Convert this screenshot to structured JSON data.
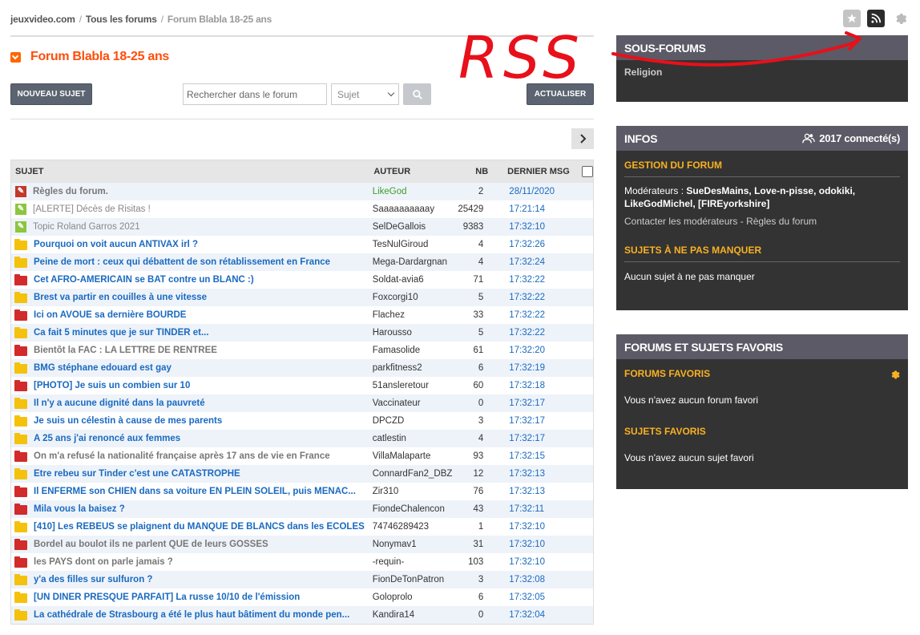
{
  "breadcrumb": {
    "site": "jeuxvideo.com",
    "forums": "Tous les forums",
    "current": "Forum Blabla 18-25 ans"
  },
  "forum": {
    "title": "Forum Blabla 18-25 ans"
  },
  "toolbar": {
    "new_topic": "NOUVEAU SUJET",
    "search_placeholder": "Rechercher dans le forum",
    "search_scope": "Sujet",
    "refresh": "ACTUALISER"
  },
  "table": {
    "headers": {
      "subject": "SUJET",
      "author": "AUTEUR",
      "nb": "NB",
      "last": "DERNIER MSG"
    },
    "rows": [
      {
        "icon": "pin-red",
        "subject": "Règles du forum.",
        "author": "LikeGod",
        "nb": "2",
        "last": "28/11/2020"
      },
      {
        "icon": "pin-green",
        "subject": "[ALERTE] Décès de Risitas !",
        "author": "Saaaaaaaaaay",
        "nb": "25429",
        "last": "17:21:14"
      },
      {
        "icon": "pin-green",
        "subject": "Topic Roland Garros 2021",
        "author": "SelDeGallois",
        "nb": "9383",
        "last": "17:32:10"
      },
      {
        "icon": "folder-yellow",
        "subject": "Pourquoi on voit aucun ANTIVAX irl ?",
        "author": "TesNulGiroud",
        "nb": "4",
        "last": "17:32:26"
      },
      {
        "icon": "folder-yellow",
        "subject": "Peine de mort : ceux qui débattent de son rétablissement en France",
        "author": "Mega-Dardargnan",
        "nb": "4",
        "last": "17:32:24"
      },
      {
        "icon": "folder-red",
        "subject": "Cet AFRO-AMÉRICAIN se BAT contre un BLANC :)",
        "author": "Soldat-avia6",
        "nb": "71",
        "last": "17:32:22"
      },
      {
        "icon": "folder-yellow",
        "subject": "Brest va partir en couilles à une vitesse",
        "author": "Foxcorgi10",
        "nb": "5",
        "last": "17:32:22"
      },
      {
        "icon": "folder-red",
        "subject": "Ici on AVOUE sa dernière BOURDE",
        "author": "Flachez",
        "nb": "33",
        "last": "17:32:22"
      },
      {
        "icon": "folder-yellow",
        "subject": "Ca fait 5 minutes que je sur TINDER et...",
        "author": "Harousso",
        "nb": "5",
        "last": "17:32:22"
      },
      {
        "icon": "folder-red",
        "subject": "Bientôt la FAC : LA LETTRE DE RENTRÉE",
        "author": "Famasolide",
        "nb": "61",
        "last": "17:32:20"
      },
      {
        "icon": "folder-yellow",
        "subject": "BMG stéphane edouard est gay",
        "author": "parkfitness2",
        "nb": "6",
        "last": "17:32:19"
      },
      {
        "icon": "folder-red",
        "subject": "[PHOTO] Je suis un combien sur 10",
        "author": "51ansleretour",
        "nb": "60",
        "last": "17:32:18"
      },
      {
        "icon": "folder-yellow",
        "subject": "Il n'y a aucune dignité dans la pauvreté",
        "author": "Vaccinateur",
        "nb": "0",
        "last": "17:32:17"
      },
      {
        "icon": "folder-yellow",
        "subject": "Je suis un célestin à cause de mes parents",
        "author": "DPCZD",
        "nb": "3",
        "last": "17:32:17"
      },
      {
        "icon": "folder-yellow",
        "subject": "A 25 ans j'ai renoncé aux femmes",
        "author": "catlestin",
        "nb": "4",
        "last": "17:32:17"
      },
      {
        "icon": "folder-red",
        "subject": "On m'a refusé la nationalité française après 17 ans de vie en France",
        "author": "VillaMalaparte",
        "nb": "93",
        "last": "17:32:15"
      },
      {
        "icon": "folder-yellow",
        "subject": "Être rebeu sur Tinder c'est une CATASTROPHE",
        "author": "ConnardFan2_DBZ",
        "nb": "12",
        "last": "17:32:13"
      },
      {
        "icon": "folder-red",
        "subject": "Il ENFERME son CHIEN dans sa voiture EN PLEIN SOLEIL, puis MENAC...",
        "author": "Zir310",
        "nb": "76",
        "last": "17:32:13"
      },
      {
        "icon": "folder-red",
        "subject": "Mila vous la baisez ?",
        "author": "FiondeChalencon",
        "nb": "43",
        "last": "17:32:11"
      },
      {
        "icon": "folder-yellow",
        "subject": "[410] Les REBEUS se plaignent du MANQUE DE BLANCS dans les ÉCOLES",
        "author": "74746289423",
        "nb": "1",
        "last": "17:32:10"
      },
      {
        "icon": "folder-red",
        "subject": "Bordel au boulot ils ne parlent QUE de leurs GOSSES",
        "author": "Nonymav1",
        "nb": "31",
        "last": "17:32:10"
      },
      {
        "icon": "folder-red",
        "subject": "les PAYS dont on parle jamais ?",
        "author": "-requin-",
        "nb": "103",
        "last": "17:32:10"
      },
      {
        "icon": "folder-yellow",
        "subject": "y'a des filles sur sulfuron ?",
        "author": "FionDeTonPatron",
        "nb": "3",
        "last": "17:32:08"
      },
      {
        "icon": "folder-yellow",
        "subject": "[UN DÎNER PRESQUE PARFAIT] La russe 10/10 de l'émission",
        "author": "Goloprolo",
        "nb": "6",
        "last": "17:32:05"
      },
      {
        "icon": "folder-yellow",
        "subject": "La cathédrale de Strasbourg a été le plus haut bâtiment du monde pen...",
        "author": "Kandira14",
        "nb": "0",
        "last": "17:32:04"
      }
    ]
  },
  "sidebar": {
    "subforums": {
      "title": "SOUS-FORUMS",
      "items": [
        "Religion"
      ]
    },
    "infos": {
      "title": "INFOS",
      "connected": "2017 connecté(s)",
      "management_title": "GESTION DU FORUM",
      "moderators_label": "Modérateurs :",
      "moderators": "SueDesMains, Love-n-pisse, odokiki, LikeGodMichel, [FIREyorkshire]",
      "contact": "Contacter les modérateurs",
      "rules": "Règles du forum",
      "sep": " - ",
      "must_see_title": "SUJETS À NE PAS MANQUER",
      "must_see_text": "Aucun sujet à ne pas manquer"
    },
    "favorites": {
      "title": "FORUMS ET SUJETS FAVORIS",
      "forums_title": "FORUMS FAVORIS",
      "forums_text": "Vous n'avez aucun forum favori",
      "topics_title": "SUJETS FAVORIS",
      "topics_text": "Vous n'avez aucun sujet favori"
    }
  },
  "annotation": {
    "text": "RSS",
    "color": "#e8101a"
  },
  "colors": {
    "accent": "#ff4e0b",
    "link": "#1a6ac0",
    "sidebar_bg": "#333333",
    "sidebar_head": "#5b5a66",
    "sidebar_section": "#f9b122",
    "folder_yellow": "#f4c20d",
    "folder_red": "#d12b2b"
  }
}
